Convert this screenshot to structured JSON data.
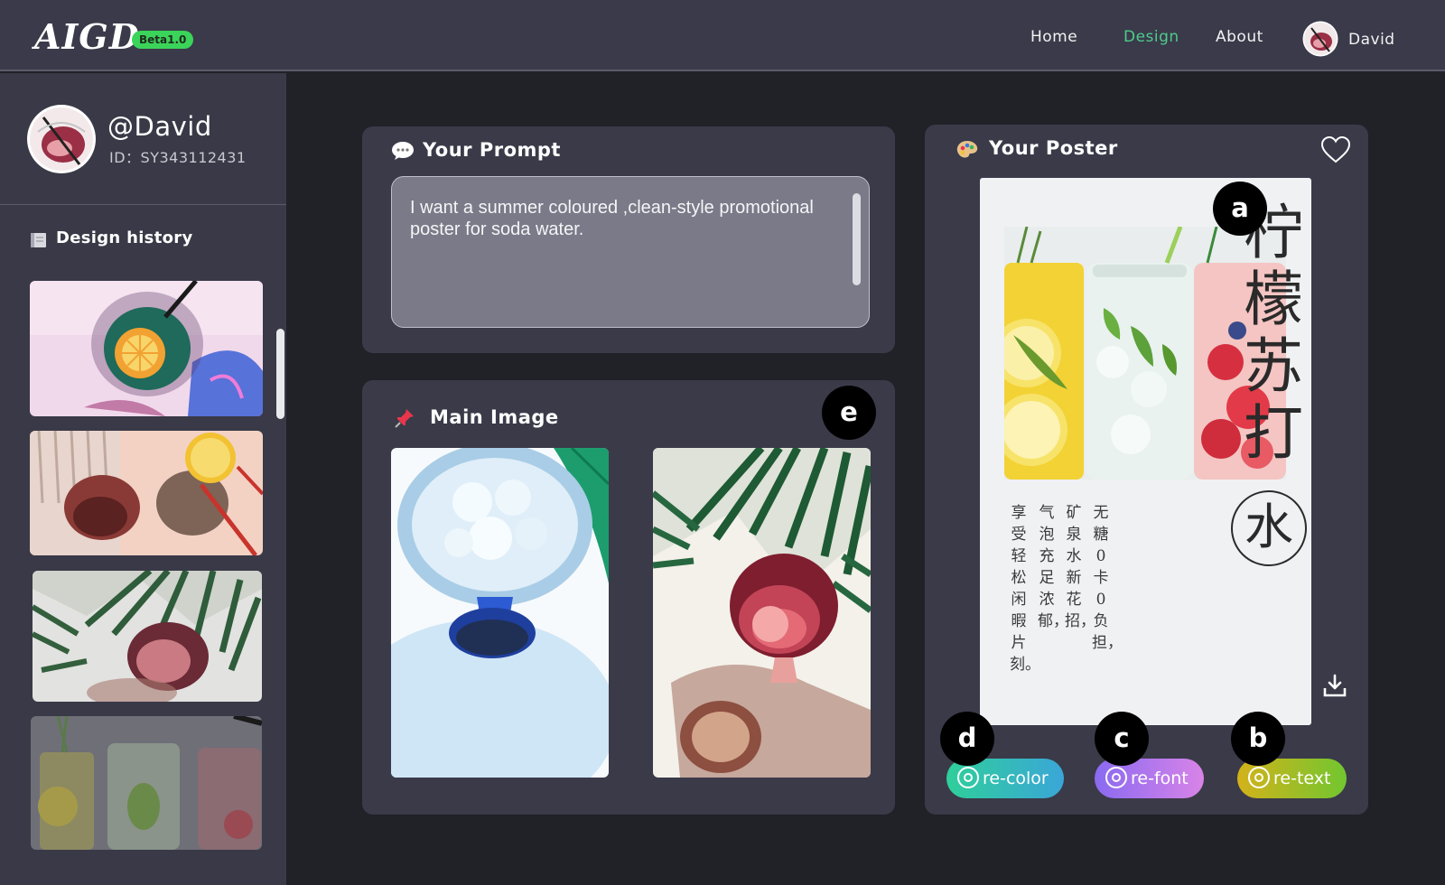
{
  "header": {
    "logo": "AIGD",
    "badge": "Beta1.0",
    "nav": {
      "home": "Home",
      "design": "Design",
      "about": "About"
    },
    "user": "David"
  },
  "sidebar": {
    "username": "@David",
    "user_id": "ID：SY343112431",
    "history_title": "Design history"
  },
  "prompt": {
    "title": "Your Prompt",
    "text": "I want a summer coloured ,clean-style promotional poster for soda water."
  },
  "main_image": {
    "title": "Main Image"
  },
  "poster": {
    "title": "Your Poster",
    "headline_chars": [
      "柠",
      "檬",
      "苏",
      "打"
    ],
    "ring_char": "水",
    "body_columns": [
      "无糖0卡0负担，",
      "矿泉水新花招，",
      "气泡充足浓郁，",
      "享受轻松闲暇片刻。"
    ]
  },
  "actions": {
    "recolor": "re-color",
    "refont": "re-font",
    "retext": "re-text"
  },
  "markers": {
    "a": "a",
    "b": "b",
    "c": "c",
    "d": "d",
    "e": "e"
  },
  "colors": {
    "accent_green": "#4ecb8c",
    "beta_green": "#3bd45a",
    "card_bg": "#3a3a49",
    "page_bg": "#212128"
  }
}
